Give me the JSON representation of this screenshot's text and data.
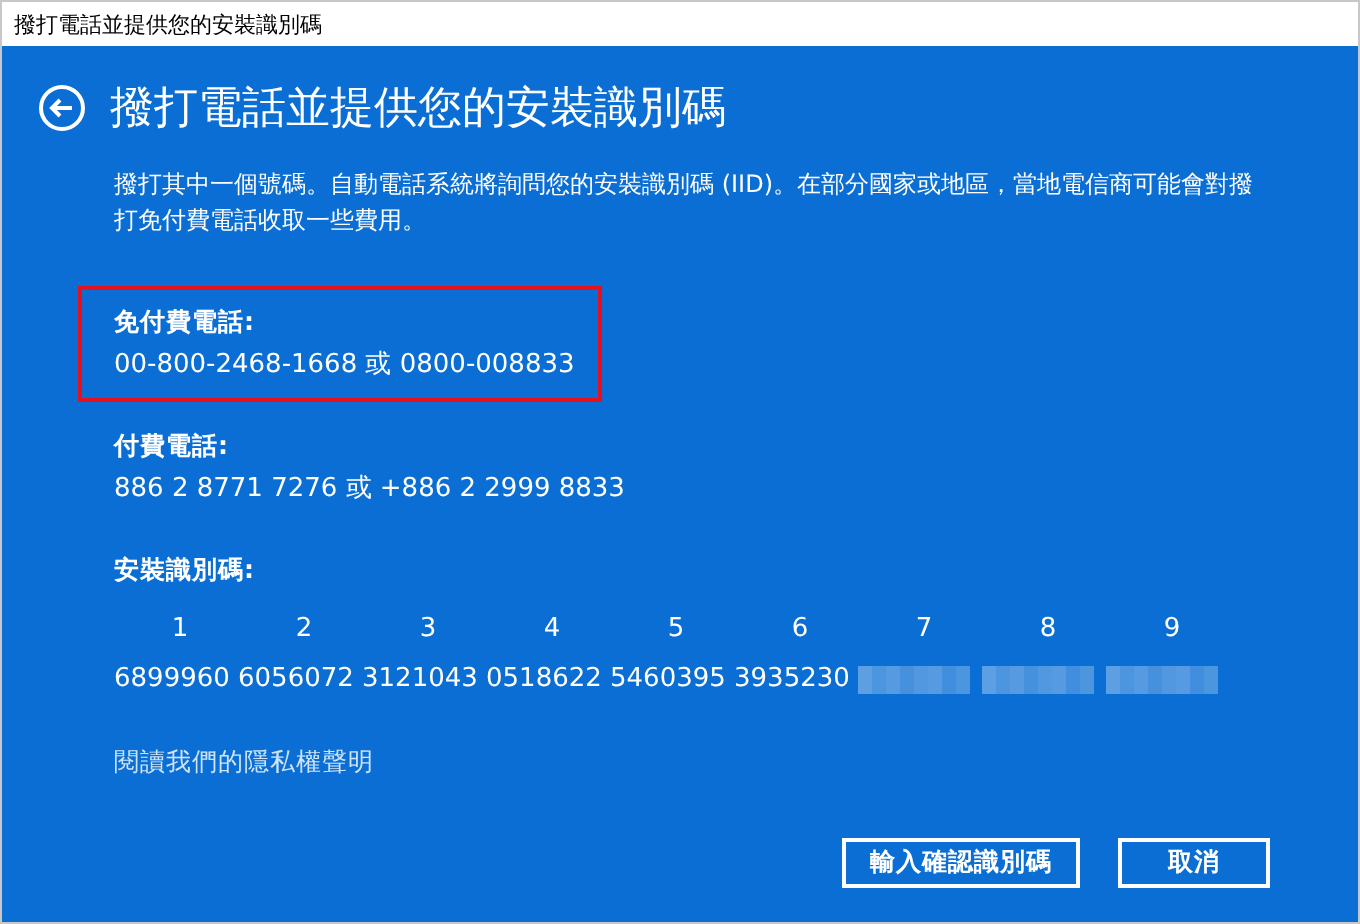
{
  "window": {
    "title": "撥打電話並提供您的安裝識別碼"
  },
  "heading": "撥打電話並提供您的安裝識別碼",
  "description": "撥打其中一個號碼。自動電話系統將詢問您的安裝識別碼 (IID)。在部分國家或地區，當地電信商可能會對撥打免付費電話收取一些費用。",
  "phone_sections": [
    {
      "label": "免付費電話:",
      "numbers": "00-800-2468-1668 或 0800-008833",
      "highlighted": true
    },
    {
      "label": "付費電話:",
      "numbers": "886 2 8771 7276 或 +886 2 2999 8833",
      "highlighted": false
    }
  ],
  "installation_id": {
    "label": "安裝識別碼:",
    "groups": [
      {
        "column": "1",
        "value": "6899960",
        "blurred": false
      },
      {
        "column": "2",
        "value": "6056072",
        "blurred": false
      },
      {
        "column": "3",
        "value": "3121043",
        "blurred": false
      },
      {
        "column": "4",
        "value": "0518622",
        "blurred": false
      },
      {
        "column": "5",
        "value": "5460395",
        "blurred": false
      },
      {
        "column": "6",
        "value": "3935230",
        "blurred": false
      },
      {
        "column": "7",
        "blurred": true
      },
      {
        "column": "8",
        "blurred": true
      },
      {
        "column": "9",
        "blurred": true
      }
    ]
  },
  "privacy_link": "閱讀我們的隱私權聲明",
  "buttons": [
    "輸入確認識別碼",
    "取消"
  ]
}
